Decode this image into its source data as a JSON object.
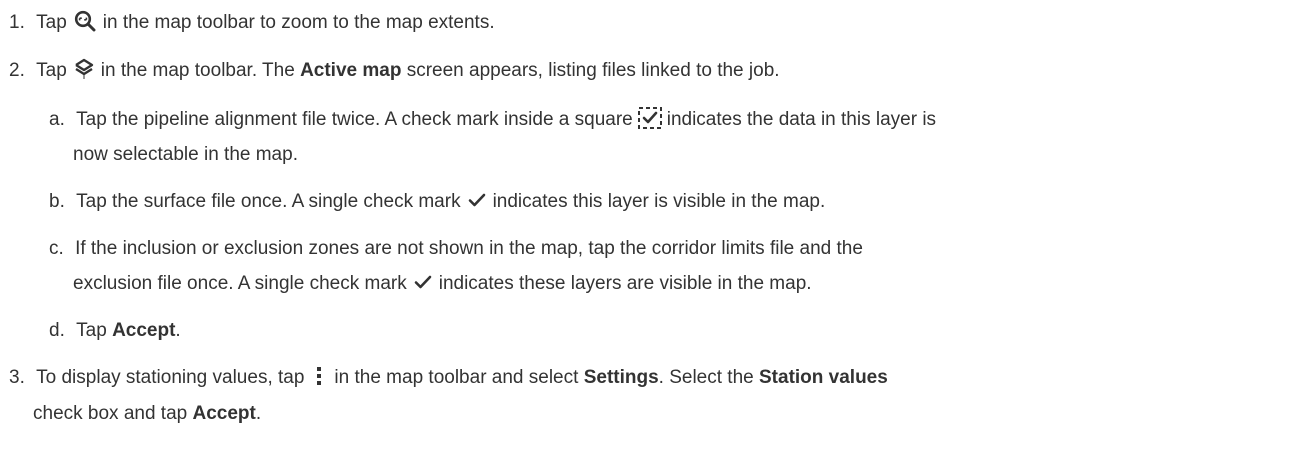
{
  "steps": [
    {
      "num": "1.",
      "p1": "Tap",
      "icon": "zoom-extents-icon",
      "p2": "in the map toolbar to zoom to the map extents."
    },
    {
      "num": "2.",
      "p1": "Tap",
      "icon": "layers-icon",
      "p2": "in the map toolbar. The",
      "bold1": "Active map",
      "p3": "screen appears, listing files linked to the job."
    },
    {
      "num": "3.",
      "p1": "To display stationing values, tap",
      "icon": "more-vertical-icon",
      "p2": "in the map toolbar and select",
      "bold1": "Settings",
      "p3": ". Select the",
      "bold2": "Station values",
      "line2a": "check box and tap",
      "line2bold": "Accept",
      "line2b": "."
    }
  ],
  "substeps": [
    {
      "letter": "a.",
      "p1": "Tap the pipeline alignment file twice. A check mark inside a square",
      "icon": "dashed-checkbox-icon",
      "p2": "indicates the data in this layer is",
      "line2": "now selectable in the map."
    },
    {
      "letter": "b.",
      "p1": "Tap the surface file once. A single check mark",
      "icon": "check-mark-icon",
      "p2": "indicates this layer is visible in the map."
    },
    {
      "letter": "c.",
      "p1": "If the inclusion or exclusion zones are not shown in the map, tap the corridor limits file and the",
      "line2a": "exclusion file once. A single check mark",
      "icon": "check-mark-icon",
      "line2b": "indicates these layers are visible in the map."
    },
    {
      "letter": "d.",
      "p1": "Tap",
      "bold1": "Accept",
      "p2": "."
    }
  ],
  "colors": {
    "text": "#333333",
    "icon": "#333333",
    "background": "#ffffff"
  }
}
